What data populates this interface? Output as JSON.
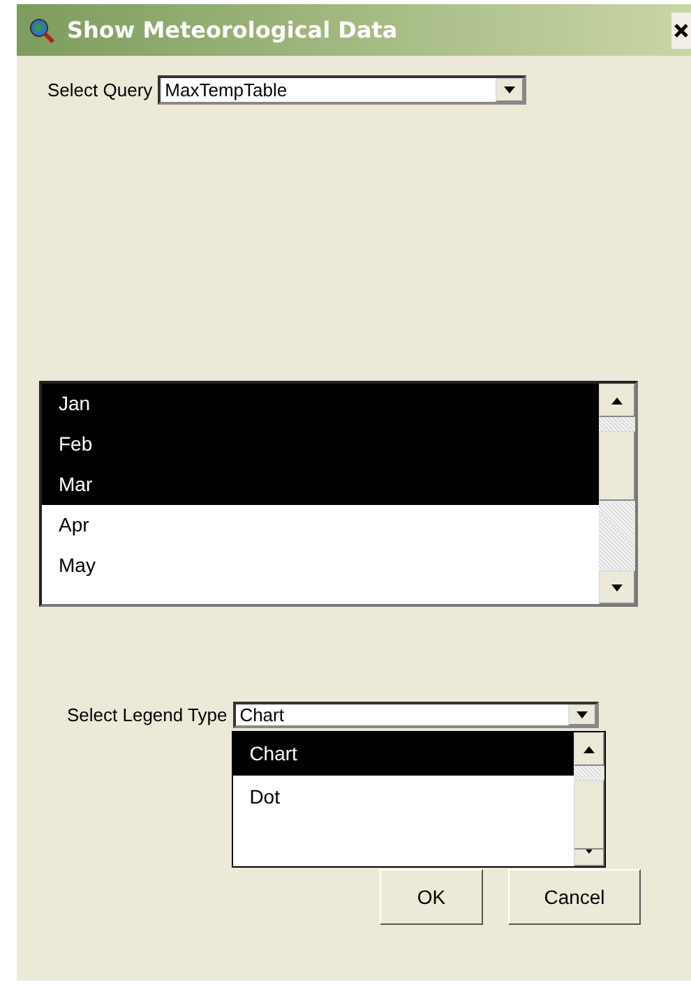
{
  "window": {
    "title": "Show Meteorological Data"
  },
  "query": {
    "label": "Select Query",
    "value": "MaxTempTable"
  },
  "months": [
    {
      "label": "Jan",
      "selected": true
    },
    {
      "label": "Feb",
      "selected": true
    },
    {
      "label": "Mar",
      "selected": true
    },
    {
      "label": "Apr",
      "selected": false
    },
    {
      "label": "May",
      "selected": false
    }
  ],
  "legend": {
    "label": "Select Legend Type",
    "value": "Chart",
    "expanded": true,
    "options": [
      {
        "label": "Chart",
        "selected": true
      },
      {
        "label": "Dot",
        "selected": false
      }
    ]
  },
  "buttons": [
    "OK",
    "Cancel"
  ]
}
